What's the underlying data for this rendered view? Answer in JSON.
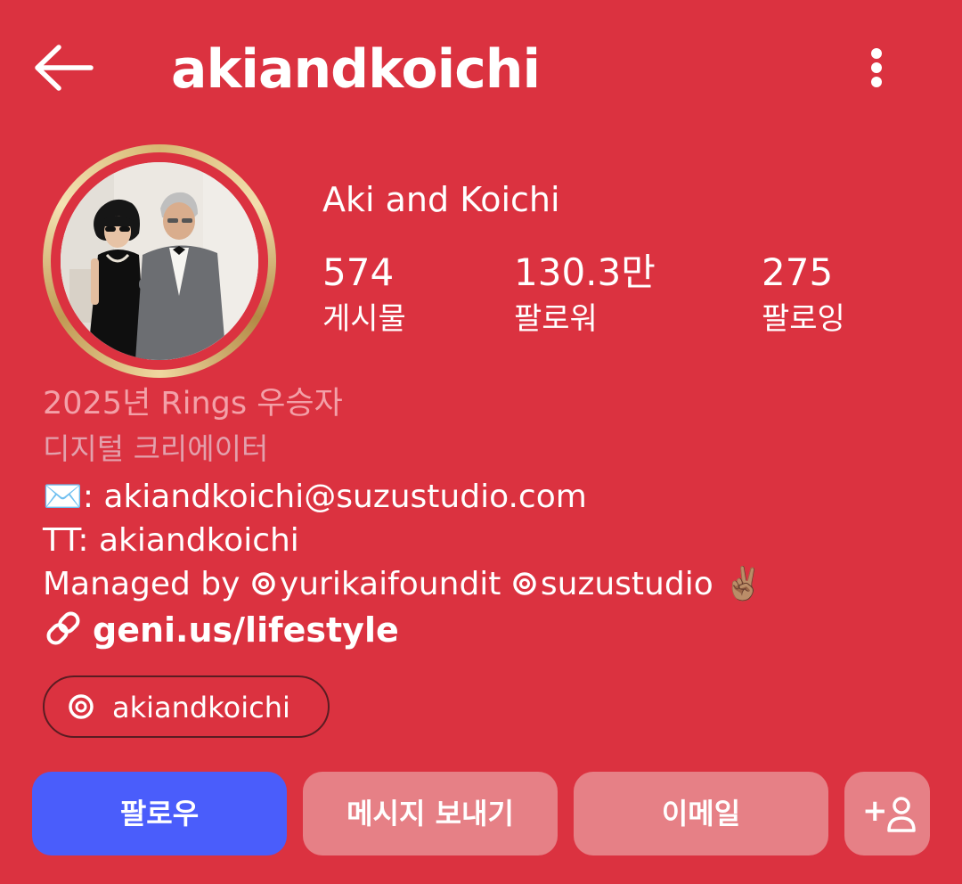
{
  "header": {
    "username": "akiandkoichi",
    "back_icon": "arrow-left-icon",
    "more_icon": "more-vertical-icon"
  },
  "profile": {
    "display_name": "Aki and Koichi",
    "stats": [
      {
        "value": "574",
        "label": "게시물"
      },
      {
        "value": "130.3만",
        "label": "팔로워"
      },
      {
        "value": "275",
        "label": "팔로잉"
      }
    ],
    "award": "2025년 Rings 우승자",
    "category": "디지털 크리에이터",
    "bio": {
      "email_emoji": "✉️",
      "email_line": ": akiandkoichi@suzustudio.com",
      "tt_line": "TT: akiandkoichi",
      "managed_prefix": "Managed by ",
      "manager_1": "yurikaifoundit",
      "manager_2": "suzustudio",
      "managed_emoji": "✌🏽"
    },
    "link": "geni.us/lifestyle",
    "threads_handle": "akiandkoichi"
  },
  "actions": {
    "follow": "팔로우",
    "message": "메시지 보내기",
    "email": "이메일",
    "suggest": "+"
  },
  "colors": {
    "background": "#db3240",
    "follow_button": "#4a5dfb",
    "secondary_button": "#e68086",
    "ring_gold": "#d7b873"
  }
}
